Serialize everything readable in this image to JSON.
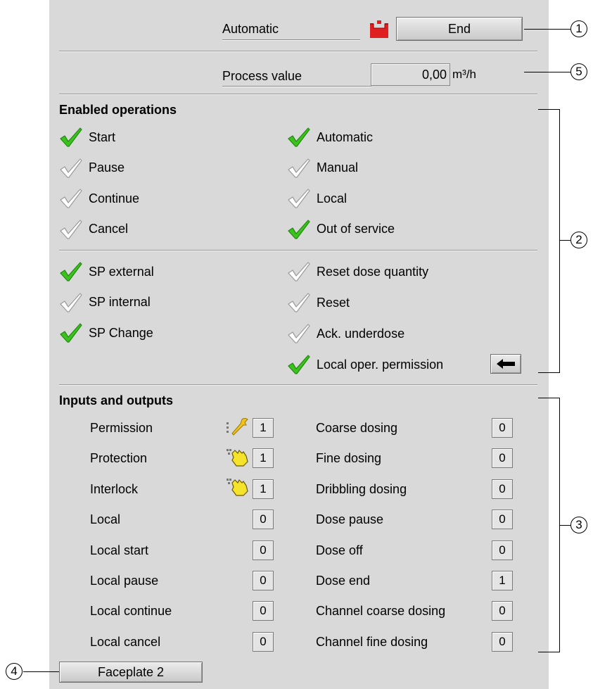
{
  "mode": {
    "label": "Automatic",
    "state": "End",
    "icon": "dosing-state-icon"
  },
  "process": {
    "label": "Process value",
    "value": "0,00",
    "unit": "m³/h"
  },
  "enabled_operations": {
    "title": "Enabled operations",
    "left": [
      {
        "label": "Start",
        "enabled": true
      },
      {
        "label": "Pause",
        "enabled": false
      },
      {
        "label": "Continue",
        "enabled": false
      },
      {
        "label": "Cancel",
        "enabled": false
      }
    ],
    "right": [
      {
        "label": "Automatic",
        "enabled": true
      },
      {
        "label": "Manual",
        "enabled": false
      },
      {
        "label": "Local",
        "enabled": false
      },
      {
        "label": "Out of service",
        "enabled": true
      }
    ],
    "left2": [
      {
        "label": "SP external",
        "enabled": true
      },
      {
        "label": "SP internal",
        "enabled": false
      },
      {
        "label": "SP Change",
        "enabled": true
      }
    ],
    "right2": [
      {
        "label": "Reset dose quantity",
        "enabled": false
      },
      {
        "label": "Reset",
        "enabled": false
      },
      {
        "label": "Ack. underdose",
        "enabled": false
      },
      {
        "label": "Local oper. permission",
        "enabled": true
      }
    ],
    "arrow_icon": "arrow-left-icon"
  },
  "io": {
    "title": "Inputs and outputs",
    "left": [
      {
        "label": "Permission",
        "value": "1",
        "icon": "wrench-icon"
      },
      {
        "label": "Protection",
        "value": "1",
        "icon": "hand-icon"
      },
      {
        "label": "Interlock",
        "value": "1",
        "icon": "hand-icon"
      },
      {
        "label": "Local",
        "value": "0"
      },
      {
        "label": "Local start",
        "value": "0"
      },
      {
        "label": "Local pause",
        "value": "0"
      },
      {
        "label": "Local continue",
        "value": "0"
      },
      {
        "label": "Local cancel",
        "value": "0"
      }
    ],
    "right": [
      {
        "label": "Coarse dosing",
        "value": "0"
      },
      {
        "label": "Fine dosing",
        "value": "0"
      },
      {
        "label": "Dribbling dosing",
        "value": "0"
      },
      {
        "label": "Dose pause",
        "value": "0"
      },
      {
        "label": "Dose off",
        "value": "0"
      },
      {
        "label": "Dose end",
        "value": "1"
      },
      {
        "label": "Channel coarse dosing",
        "value": "0"
      },
      {
        "label": "Channel fine dosing",
        "value": "0"
      }
    ]
  },
  "faceplate_button": "Faceplate 2",
  "callouts": [
    "1",
    "5",
    "2",
    "3",
    "4"
  ],
  "colors": {
    "check_enabled": "#3cc21e",
    "check_disabled": "#9a9a9a",
    "panel": "#d9d9d9",
    "state_icon": "#e02020"
  }
}
